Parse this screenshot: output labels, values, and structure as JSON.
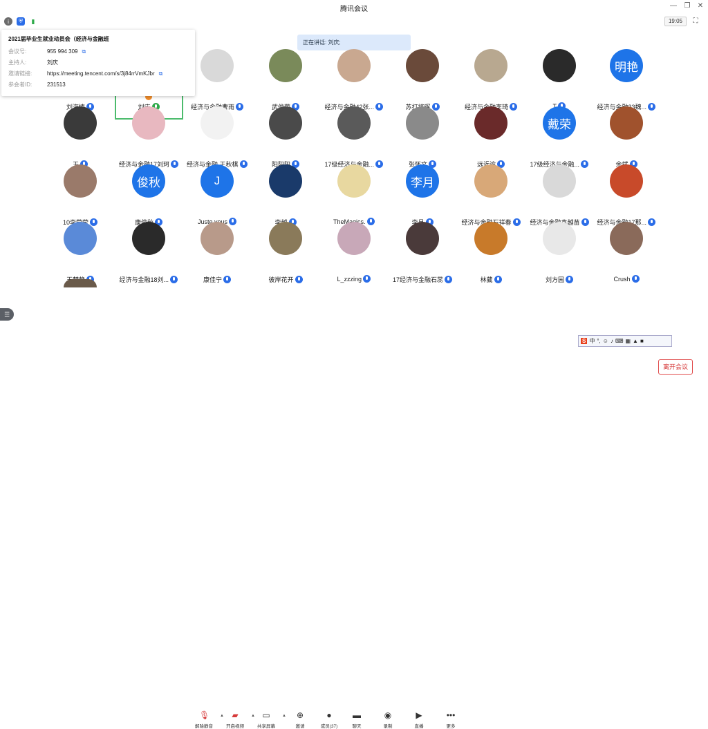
{
  "window": {
    "title": "腾讯会议",
    "clock": "19:05"
  },
  "speaking_banner": "正在讲话: 刘庆;",
  "info_panel": {
    "title": "2021届毕业生就业动员会（经济与金融班",
    "rows": [
      {
        "label": "会议号:",
        "value": "955 994 309",
        "copy": true
      },
      {
        "label": "主持人:",
        "value": "刘庆",
        "copy": false
      },
      {
        "label": "邀请链接:",
        "value": "https://meeting.tencent.com/s/3j84rrVmKJbr",
        "copy": true
      },
      {
        "label": "参会者ID:",
        "value": "231513",
        "copy": false
      }
    ]
  },
  "participants": [
    {
      "name": "刘海情",
      "avatar_text": "",
      "color": "#8a7a6a"
    },
    {
      "name": "刘庆",
      "avatar_text": "",
      "color": "#ffffff",
      "host": true
    },
    {
      "name": "经济与金融曹雨",
      "avatar_text": "",
      "color": "#d9d9d9"
    },
    {
      "name": "武俊荣",
      "avatar_text": "",
      "color": "#7a8a5a"
    },
    {
      "name": "经济与金融42张...",
      "avatar_text": "",
      "color": "#c9a890"
    },
    {
      "name": "苏打将晖",
      "avatar_text": "",
      "color": "#6a4a3a"
    },
    {
      "name": "经济与金融李琦",
      "avatar_text": "",
      "color": "#b8a890"
    },
    {
      "name": "T",
      "avatar_text": "",
      "color": "#2a2a2a"
    },
    {
      "name": "经济与金融33魏...",
      "avatar_text": "明艳",
      "color": "#1e74e8"
    },
    {
      "name": "王",
      "avatar_text": "",
      "color": "#3a3a3a"
    },
    {
      "name": "经济与金融17刘珂",
      "avatar_text": "",
      "color": "#e8b8c0"
    },
    {
      "name": "经济与金融 王秋棋",
      "avatar_text": "",
      "color": "#f2f2f2"
    },
    {
      "name": "阳阳阳",
      "avatar_text": "",
      "color": "#4a4a4a"
    },
    {
      "name": "17级经济与金融...",
      "avatar_text": "",
      "color": "#5a5a5a"
    },
    {
      "name": "张怀文",
      "avatar_text": "",
      "color": "#8a8a8a"
    },
    {
      "name": "远近逾",
      "avatar_text": "",
      "color": "#6a2a2a"
    },
    {
      "name": "17级经济与金融...",
      "avatar_text": "戴荣",
      "color": "#1e74e8"
    },
    {
      "name": "余斌",
      "avatar_text": "",
      "color": "#a0522d"
    },
    {
      "name": "10李莹莹",
      "avatar_text": "",
      "color": "#9a7a6a"
    },
    {
      "name": "康俊秋",
      "avatar_text": "俊秋",
      "color": "#1e74e8"
    },
    {
      "name": "Juste vous",
      "avatar_text": "J",
      "color": "#1e74e8"
    },
    {
      "name": "李越",
      "avatar_text": "",
      "color": "#1a3a6a"
    },
    {
      "name": "TheMagics.",
      "avatar_text": "",
      "color": "#e8d8a0"
    },
    {
      "name": "李月",
      "avatar_text": "李月",
      "color": "#1e74e8"
    },
    {
      "name": "经济与金融石祥春",
      "avatar_text": "",
      "color": "#d8a878"
    },
    {
      "name": "经济与金融袁越苗",
      "avatar_text": "",
      "color": "#d9d9d9"
    },
    {
      "name": "经济与金融17那...",
      "avatar_text": "",
      "color": "#c84a2a"
    },
    {
      "name": "王梦静",
      "avatar_text": "",
      "color": "#5a8ad8"
    },
    {
      "name": "经济与金融18刘...",
      "avatar_text": "",
      "color": "#2a2a2a"
    },
    {
      "name": "康佳宁",
      "avatar_text": "",
      "color": "#b89a8a"
    },
    {
      "name": "彼岸花开",
      "avatar_text": "",
      "color": "#8a7a5a"
    },
    {
      "name": "L_zzzing",
      "avatar_text": "",
      "color": "#c8a8b8"
    },
    {
      "name": "17经济与金融石蕊",
      "avatar_text": "",
      "color": "#4a3a3a"
    },
    {
      "name": "林葳",
      "avatar_text": "",
      "color": "#c87a2a"
    },
    {
      "name": "刘方园",
      "avatar_text": "",
      "color": "#e8e8e8"
    },
    {
      "name": "Crush",
      "avatar_text": "",
      "color": "#8a6a5a"
    },
    {
      "name": "",
      "avatar_text": "",
      "color": "#6a5a4a"
    }
  ],
  "ime": {
    "mode": "中"
  },
  "toolbar": {
    "items": [
      {
        "label": "解除静音",
        "icon": "mic-off-icon"
      },
      {
        "label": "开启视频",
        "icon": "video-off-icon"
      },
      {
        "label": "共享屏幕",
        "icon": "share-screen-icon"
      },
      {
        "label": "邀请",
        "icon": "invite-icon"
      },
      {
        "label": "成员(37)",
        "icon": "members-icon"
      },
      {
        "label": "聊天",
        "icon": "chat-icon"
      },
      {
        "label": "录制",
        "icon": "record-icon"
      },
      {
        "label": "直播",
        "icon": "live-icon"
      },
      {
        "label": "更多",
        "icon": "more-icon"
      }
    ],
    "leave_label": "离开会议"
  }
}
